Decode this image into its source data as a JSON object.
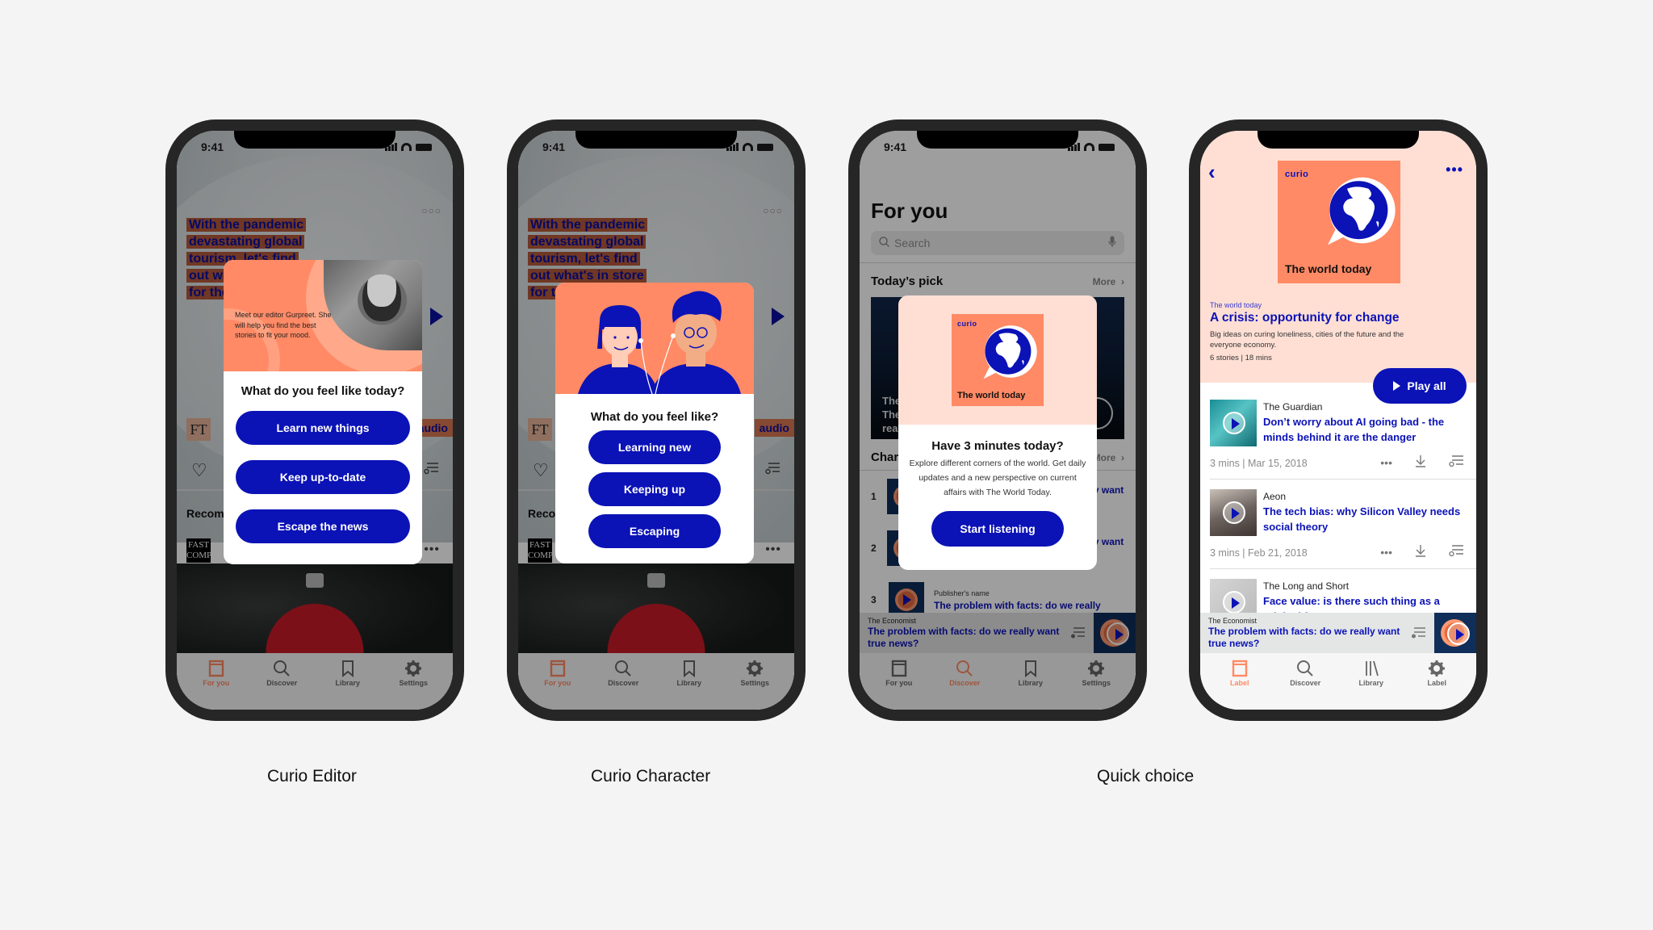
{
  "page": {
    "background": "#f4f4f4",
    "captions": [
      "Curio Editor",
      "Curio Character",
      "Quick choice"
    ]
  },
  "colors": {
    "brand_blue": "#0b12b6",
    "brand_orange": "#ff8a65",
    "peach": "#ffdfd4",
    "phone_frame": "#262626"
  },
  "status_bar": {
    "time": "9:41"
  },
  "article": {
    "headline_lines": [
      "With the pandemic",
      "devastating global",
      "tourism, let's find",
      "out what's in store",
      "for the industry"
    ],
    "publisher_logo": "FT",
    "tag": "audio",
    "section": "Recommended",
    "row_logo": "FAST COMPANY",
    "more_dots": "•••"
  },
  "tabbar_main": [
    {
      "label": "For you",
      "icon": "book-icon",
      "active": true
    },
    {
      "label": "Discover",
      "icon": "search-icon",
      "active": false
    },
    {
      "label": "Library",
      "icon": "bookmark-icon",
      "active": false
    },
    {
      "label": "Settings",
      "icon": "gear-icon",
      "active": false
    }
  ],
  "editor_modal": {
    "intro": "Meet our editor Gurpreet. She will help you find the best stories to fit your mood.",
    "question": "What do you feel like today?",
    "options": [
      "Learn new things",
      "Keep up-to-date",
      "Escape the news"
    ]
  },
  "character_modal": {
    "question": "What do you feel like?",
    "options": [
      "Learning new",
      "Keeping up",
      "Escaping"
    ]
  },
  "for_you_screen": {
    "title": "For you",
    "search_placeholder": "Search",
    "todays_pick": {
      "heading": "Today’s pick",
      "more": "More",
      "card_lines": [
        "The",
        "The",
        "rea"
      ]
    },
    "charts": {
      "heading": "Charts",
      "more": "More",
      "rows": [
        {
          "rank": "1",
          "publisher": "",
          "title": "The problem with facts: do we really want true news?"
        },
        {
          "rank": "2",
          "publisher": "",
          "title": "The problem with facts: do we really want true news?"
        },
        {
          "rank": "3",
          "publisher": "Publisher's name",
          "title": "The problem with facts: do we really"
        }
      ]
    },
    "tabs": [
      {
        "label": "For you",
        "active": false
      },
      {
        "label": "Discover",
        "active": true
      },
      {
        "label": "Library",
        "active": false
      },
      {
        "label": "Settings",
        "active": false
      }
    ]
  },
  "quick_modal": {
    "brand": "curio",
    "cover_title": "The world today",
    "question": "Have 3 minutes today?",
    "description": "Explore different corners of the world. Get daily updates and a new perspective on current affairs with The World Today.",
    "cta": "Start listening"
  },
  "mini_player": {
    "publisher": "The Economist",
    "title": "The problem with facts: do we really want true news?"
  },
  "playlist_screen": {
    "brand": "curio",
    "cover_title": "The world today",
    "subtitle": "The world today",
    "title": "A crisis: opportunity for change",
    "description": "Big ideas on curing loneliness, cities of the future and the everyone economy.",
    "meta": "6 stories | 18 mins",
    "play_all": "Play all",
    "stories": [
      {
        "publisher": "The Guardian",
        "title": "Don’t worry about AI going bad - the minds behind it are the danger",
        "meta": "3 mins | Mar 15, 2018"
      },
      {
        "publisher": "Aeon",
        "title": "The tech bias: why Silicon Valley needs social theory",
        "meta": "3 mins | Feb 21, 2018"
      },
      {
        "publisher": "The Long and Short",
        "title": "Face value: is there such thing as a original face?",
        "meta": ""
      }
    ],
    "tabs": [
      {
        "label": "Label",
        "active": true
      },
      {
        "label": "Discover",
        "active": false
      },
      {
        "label": "Library",
        "active": false
      },
      {
        "label": "Label",
        "active": false
      }
    ]
  }
}
